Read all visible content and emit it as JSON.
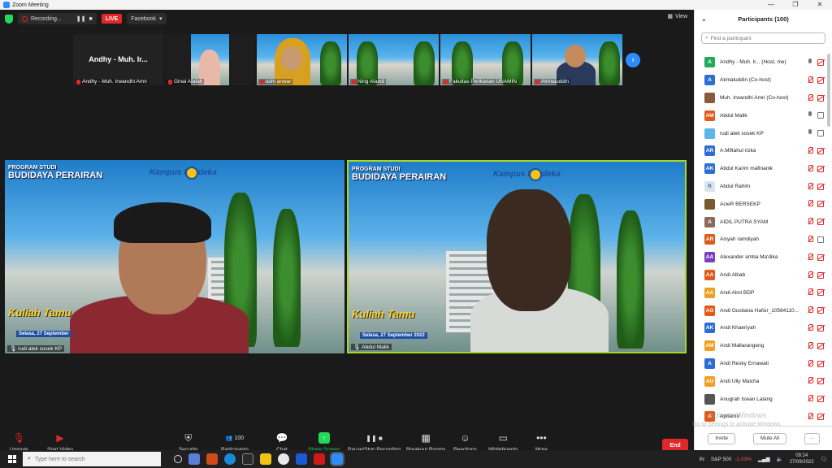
{
  "window": {
    "title": "Zoom Meeting"
  },
  "topbar": {
    "recording_label": "Recording...",
    "live_label": "LIVE",
    "stream_target": "Facebook",
    "view_label": "View"
  },
  "strip": [
    {
      "name": "Andhy - Muh. Irwandhi Amri",
      "display": "Andhy - Muh. Ir..."
    },
    {
      "name": "Ginal Afafah"
    },
    {
      "name": "ashi anwar"
    },
    {
      "name": "Ning Afandi"
    },
    {
      "name": "Fakultas Perikanan UNAMIN"
    },
    {
      "name": "Akmaluddin"
    }
  ],
  "gallery": [
    {
      "name": "rudi alek sosek KP",
      "program_line1": "PROGRAM STUDI",
      "program_line2": "BUDIDAYA PERAIRAN",
      "kampus": "Kampus Merdeka",
      "kuliah": "Kuliah Tamu",
      "date": "Selasa, 27 September"
    },
    {
      "name": "Abdul Malik",
      "program_line1": "PROGRAM STUDI",
      "program_line2": "BUDIDAYA PERAIRAN",
      "kampus": "Kampus Merdeka",
      "kuliah": "Kuliah Tamu",
      "date": "Selasa, 27 September 2022"
    }
  ],
  "toolbar": {
    "unmute": "Unmute",
    "start_video": "Start Video",
    "security": "Security",
    "participants": "Participants",
    "participants_count": "100",
    "chat": "Chat",
    "share_screen": "Share Screen",
    "pause_recording": "Pause/Stop Recording",
    "breakout_rooms": "Breakout Rooms",
    "reactions": "Reactions",
    "whiteboards": "Whiteboards",
    "more": "More",
    "end": "End"
  },
  "watermark": {
    "line1": "Activate Windows",
    "line2": "Go to Settings to activate Windows."
  },
  "panel": {
    "title": "Participants (100)",
    "search_placeholder": "Find a participant",
    "invite": "Invite",
    "mute_all": "Mute All",
    "participants": [
      {
        "name": "Andhy - Muh. Ir...  (Host, me)",
        "initials": "A",
        "color": "#23a95a",
        "mic": "on",
        "video": "off"
      },
      {
        "name": "Akmaluddin (Co-host)",
        "initials": "A",
        "color": "#2d6fd0",
        "mic": "off",
        "video": "off"
      },
      {
        "name": "Muh. Irwandhi Amri (Co-host)",
        "initials": "",
        "color": "#8a5a3c",
        "mic": "off",
        "video": "off"
      },
      {
        "name": "Abdul Malik",
        "initials": "AM",
        "color": "#e05a1a",
        "mic": "on",
        "video": "on"
      },
      {
        "name": "rudi alek sosek KP",
        "initials": "",
        "color": "#5ab8e8",
        "mic": "on",
        "video": "on"
      },
      {
        "name": "A.Miftahul rizka",
        "initials": "AR",
        "color": "#2d6fd0",
        "mic": "off",
        "video": "off"
      },
      {
        "name": "Abdul Karim mafinanik",
        "initials": "AK",
        "color": "#2d6fd0",
        "mic": "off",
        "video": "off"
      },
      {
        "name": "Abdul Rahim",
        "initials": "R",
        "color": "#dde3ea",
        "mic": "off",
        "video": "off"
      },
      {
        "name": "AcieR BERSEKP",
        "initials": "",
        "color": "#7a5a2c",
        "mic": "off",
        "video": "off"
      },
      {
        "name": "AIDIL PUTRA SYAM",
        "initials": "A",
        "color": "#8a6a5a",
        "mic": "off",
        "video": "off"
      },
      {
        "name": "Aisyah ramdiyah",
        "initials": "AR",
        "color": "#e05a1a",
        "mic": "off",
        "video": "on"
      },
      {
        "name": "Alexander amba Ma'dika",
        "initials": "AA",
        "color": "#7a3fc0",
        "mic": "off",
        "video": "off"
      },
      {
        "name": "Andi Albab",
        "initials": "AA",
        "color": "#e05a1a",
        "mic": "off",
        "video": "off"
      },
      {
        "name": "Andi Almi BDP",
        "initials": "AA",
        "color": "#f0a020",
        "mic": "off",
        "video": "off"
      },
      {
        "name": "Andi Gustiana Hafsir_10564110...",
        "initials": "AG",
        "color": "#e05a1a",
        "mic": "off",
        "video": "off"
      },
      {
        "name": "Andi Khaeriyah",
        "initials": "AK",
        "color": "#2d6fd0",
        "mic": "off",
        "video": "off"
      },
      {
        "name": "Andi Mallarangeng",
        "initials": "AM",
        "color": "#f0a020",
        "mic": "off",
        "video": "off"
      },
      {
        "name": "Andi Resky Ernawati",
        "initials": "A",
        "color": "#2d6fd0",
        "mic": "off",
        "video": "off"
      },
      {
        "name": "Andi Ully Maicha",
        "initials": "AU",
        "color": "#f0a020",
        "mic": "off",
        "video": "off"
      },
      {
        "name": "Anugrah Iswan Lalang",
        "initials": "",
        "color": "#555",
        "mic": "off",
        "video": "off"
      },
      {
        "name": "Aprianto",
        "initials": "A",
        "color": "#e05a1a",
        "mic": "off",
        "video": "off"
      }
    ]
  },
  "taskbar": {
    "search_placeholder": "Type here to search",
    "lang": "IN",
    "stock_name": "S&P 500",
    "stock_change": "-1.03%",
    "time": "09:24",
    "date": "27/09/2022"
  }
}
